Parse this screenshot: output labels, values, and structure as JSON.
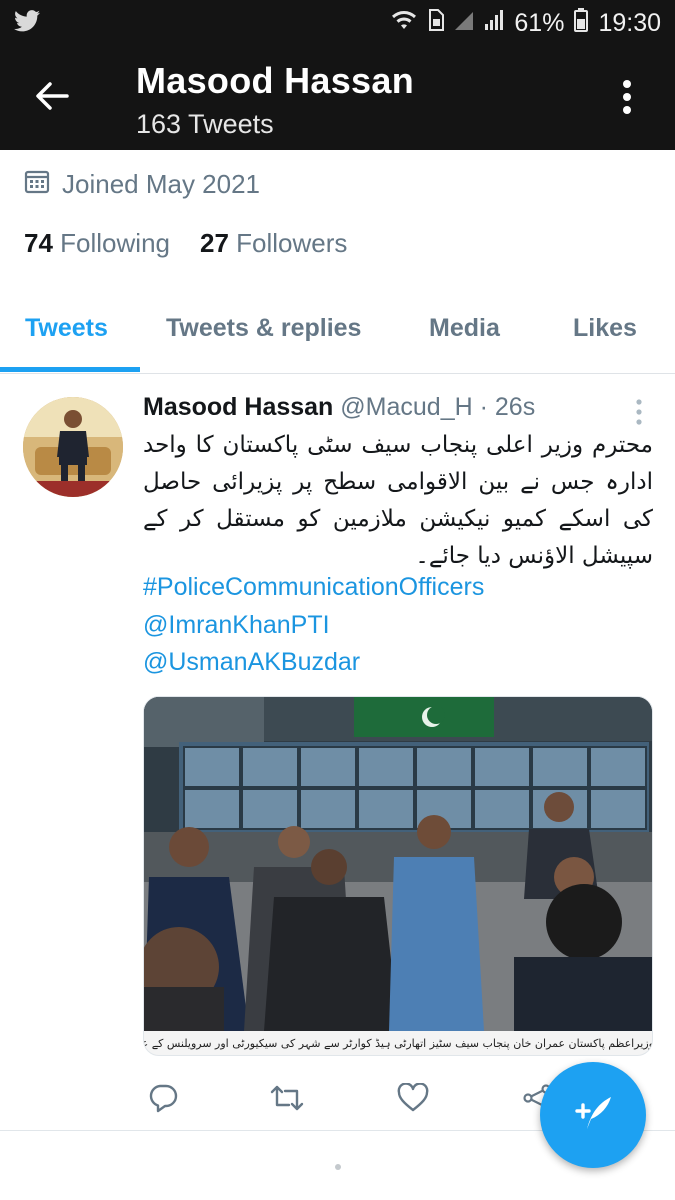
{
  "status_bar": {
    "battery": "61%",
    "time": "19:30"
  },
  "app_bar": {
    "title": "Masood Hassan",
    "subtitle": "163 Tweets"
  },
  "profile": {
    "joined": "Joined May 2021",
    "following_count": "74",
    "following_label": "Following",
    "followers_count": "27",
    "followers_label": "Followers"
  },
  "tabs": [
    {
      "label": "Tweets",
      "active": true
    },
    {
      "label": "Tweets & replies",
      "active": false
    },
    {
      "label": "Media",
      "active": false
    },
    {
      "label": "Likes",
      "active": false
    }
  ],
  "tweet": {
    "name": "Masood Hassan",
    "handle": "@Macud_H",
    "separator": "·",
    "time": "26s",
    "text": "محترم وزیر اعلی پنجاب سیف سٹی پاکستان کا واحد ادارہ جس نے بین الاقوامی سطح پر پزیرائی حاصل کی اسکے کمیو نیکیشن ملازمین کو مستقل کر کے سپیشل الاؤنس دیا جائے۔",
    "hashtag": "#PoliceCommunicationOfficers",
    "mention1": "@ImranKhanPTI",
    "mention2": "@UsmanAKBuzdar",
    "image_caption": "وزیراعظم پاکستان عمران خان پنجاب سیف سٹیز اتھارٹی ہیڈ کوارٹر سے شہر کی سیکیورٹی اور سرویلنس کے عمل کا جائزہ لے رہے ہیں"
  },
  "icons": {
    "twitter": "twitter-bird-icon",
    "back": "arrow-left-icon",
    "more": "more-vertical-icon",
    "calendar": "calendar-icon",
    "reply": "reply-icon",
    "retweet": "retweet-icon",
    "like": "heart-icon",
    "share": "share-icon",
    "compose": "compose-tweet-icon"
  },
  "colors": {
    "accent": "#1da1f2",
    "link": "#1b95e0",
    "secondary_text": "#657786",
    "appbar": "#141414"
  }
}
